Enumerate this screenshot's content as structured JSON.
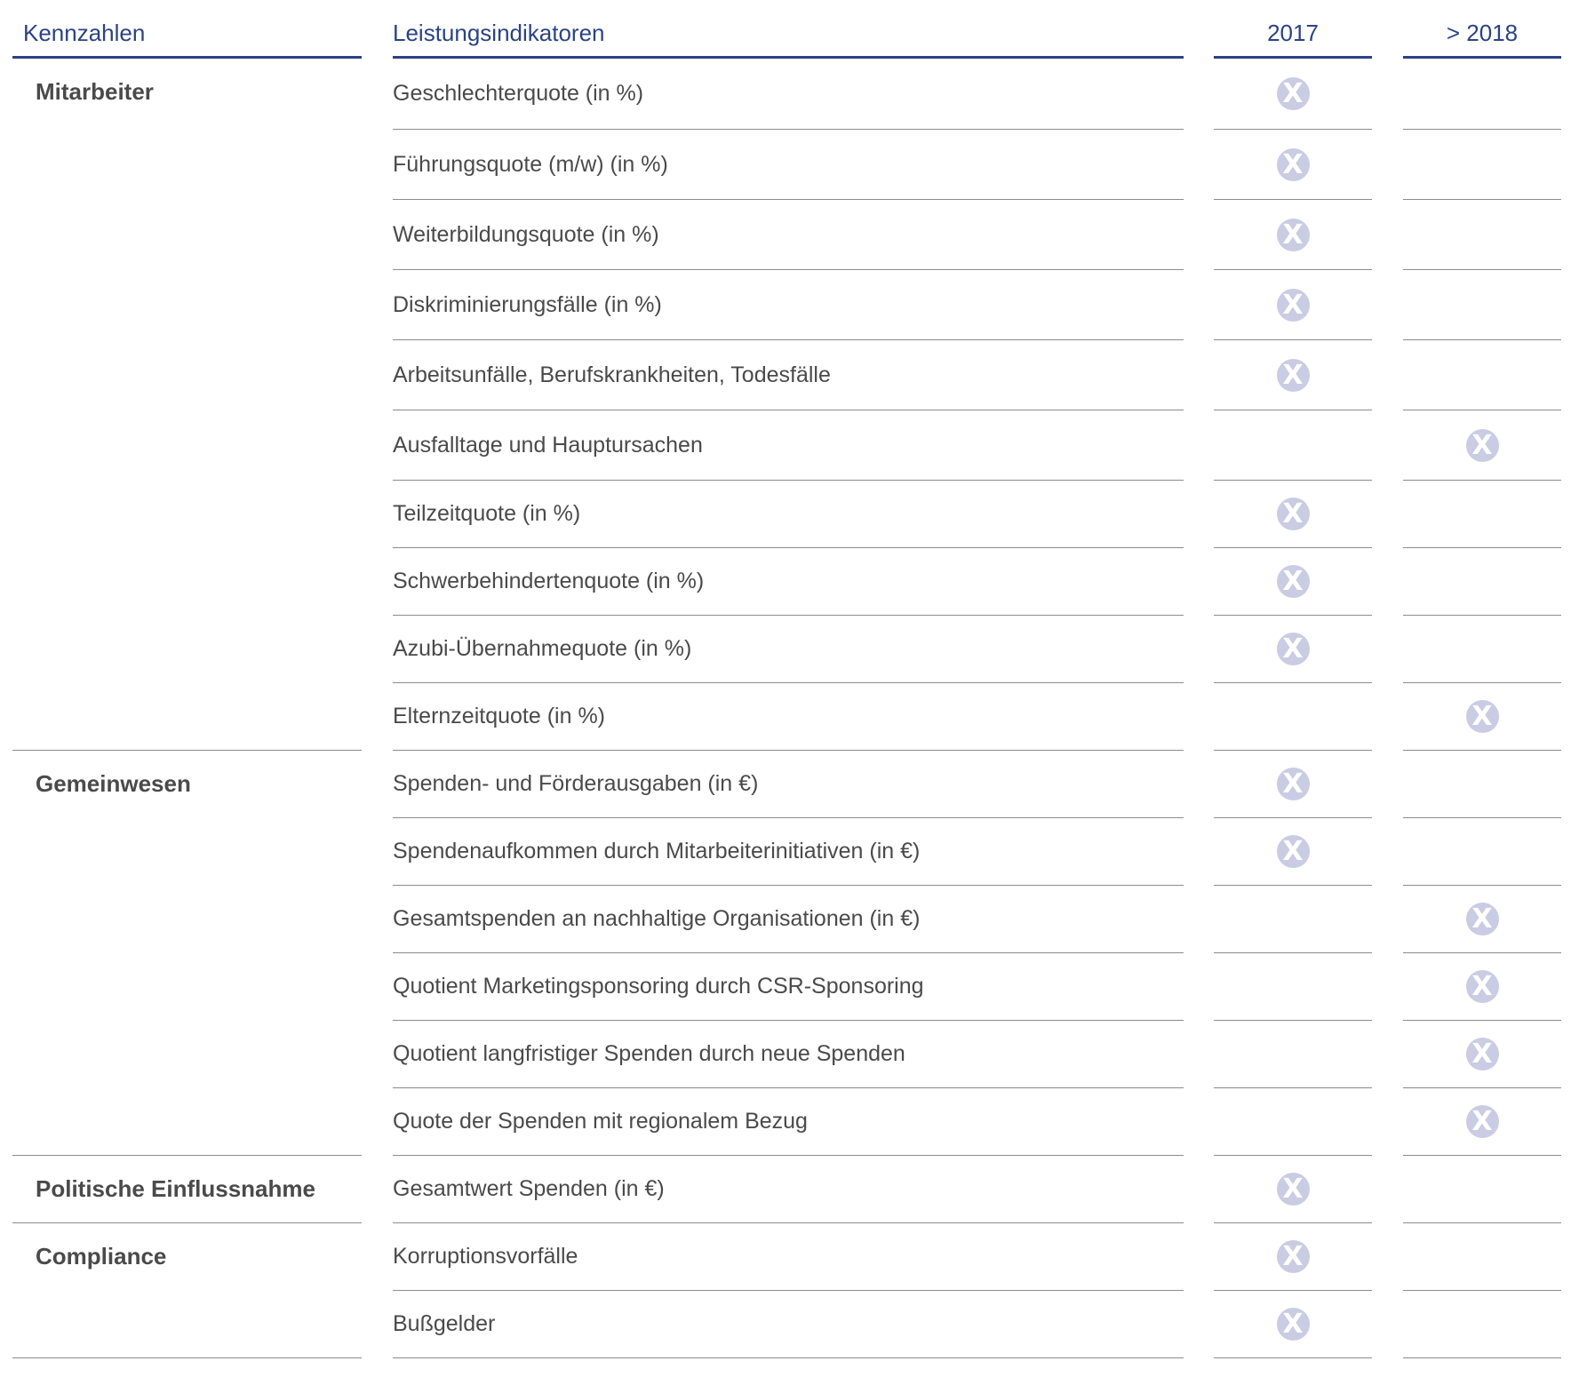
{
  "header": {
    "category": "Kennzahlen",
    "indicator": "Leistungsindikatoren",
    "year1": "2017",
    "year2": "> 2018"
  },
  "mark_glyph": "X",
  "colors": {
    "header_text": "#2b4385",
    "header_rule": "#2b4385",
    "body_text": "#4a4a4a",
    "row_rule": "#8c8c8c",
    "mark_fill": "#c9cce3"
  },
  "groups": [
    {
      "category": "Mitarbeiter",
      "rows": [
        {
          "indicator": "Geschlechterquote (in %)",
          "y2017": true,
          "y2018": false
        },
        {
          "indicator": "Führungsquote (m/w) (in %)",
          "y2017": true,
          "y2018": false
        },
        {
          "indicator": "Weiterbildungsquote (in %)",
          "y2017": true,
          "y2018": false
        },
        {
          "indicator": "Diskriminierungsfälle (in %)",
          "y2017": true,
          "y2018": false
        },
        {
          "indicator": "Arbeitsunfälle, Berufskrankheiten, Todesfälle",
          "y2017": true,
          "y2018": false
        },
        {
          "indicator": "Ausfalltage und Hauptursachen",
          "y2017": false,
          "y2018": true
        },
        {
          "indicator": "Teilzeitquote (in %)",
          "y2017": true,
          "y2018": false
        },
        {
          "indicator": "Schwerbehindertenquote (in %)",
          "y2017": true,
          "y2018": false
        },
        {
          "indicator": "Azubi-Übernahmequote (in %)",
          "y2017": true,
          "y2018": false
        },
        {
          "indicator": "Elternzeitquote (in %)",
          "y2017": false,
          "y2018": true
        }
      ]
    },
    {
      "category": "Gemeinwesen",
      "rows": [
        {
          "indicator": "Spenden- und Förderausgaben (in €)",
          "y2017": true,
          "y2018": false
        },
        {
          "indicator": "Spendenaufkommen durch Mitarbeiterinitiativen (in €)",
          "y2017": true,
          "y2018": false
        },
        {
          "indicator": "Gesamtspenden an nachhaltige Organisationen (in €)",
          "y2017": false,
          "y2018": true
        },
        {
          "indicator": "Quotient Marketingsponsoring durch CSR-Sponsoring",
          "y2017": false,
          "y2018": true
        },
        {
          "indicator": "Quotient langfristiger Spenden durch neue Spenden",
          "y2017": false,
          "y2018": true
        },
        {
          "indicator": "Quote der Spenden mit regionalem Bezug",
          "y2017": false,
          "y2018": true
        }
      ]
    },
    {
      "category": "Politische Einflussnahme",
      "rows": [
        {
          "indicator": "Gesamtwert Spenden (in €)",
          "y2017": true,
          "y2018": false
        }
      ]
    },
    {
      "category": "Compliance",
      "rows": [
        {
          "indicator": "Korruptionsvorfälle",
          "y2017": true,
          "y2018": false
        },
        {
          "indicator": "Bußgelder",
          "y2017": true,
          "y2018": false
        }
      ]
    }
  ]
}
